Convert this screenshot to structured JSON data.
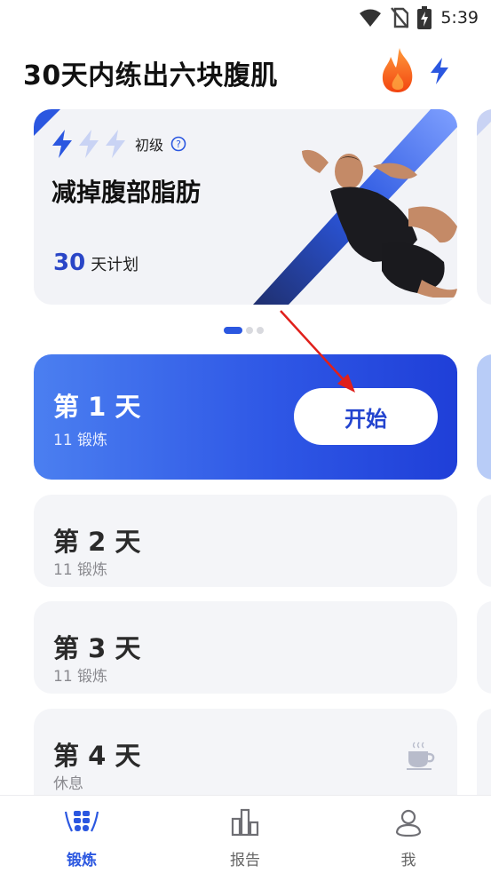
{
  "status_bar": {
    "time": "5:39"
  },
  "header": {
    "title": "30天内练出六块腹肌"
  },
  "plan": {
    "level": "初级",
    "title": "减掉腹部脂肪",
    "days_number": "30",
    "days_unit": "天计划",
    "level_filled": 1,
    "level_total": 3
  },
  "carousel": {
    "pages": 3,
    "active": 0
  },
  "days": [
    {
      "title": "第 1 天",
      "subtitle": "11 锻炼",
      "active": true,
      "button_label": "开始"
    },
    {
      "title": "第 2 天",
      "subtitle": "11 锻炼",
      "active": false
    },
    {
      "title": "第 3 天",
      "subtitle": "11 锻炼",
      "active": false
    },
    {
      "title": "第 4 天",
      "subtitle": "休息",
      "active": false,
      "rest": true
    }
  ],
  "nav": [
    {
      "label": "锻炼",
      "icon": "abs-icon",
      "active": true
    },
    {
      "label": "报告",
      "icon": "bar-chart-icon",
      "active": false
    },
    {
      "label": "我",
      "icon": "profile-icon",
      "active": false
    }
  ],
  "colors": {
    "accent": "#2b57e0",
    "active_card_start": "#4b7ff0",
    "active_card_end": "#1f3fd8",
    "fire": "#f4681e",
    "arrow": "#e0201b"
  }
}
